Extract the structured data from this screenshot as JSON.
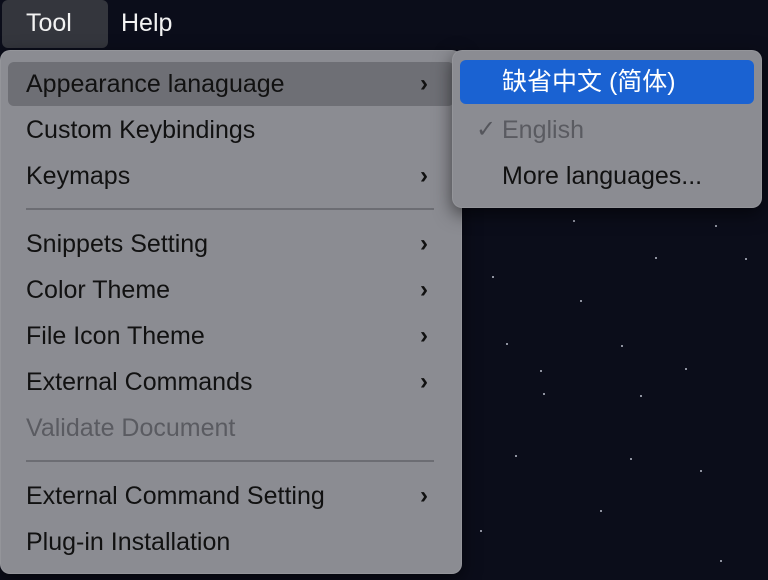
{
  "menubar": {
    "items": [
      {
        "label": "Tool"
      },
      {
        "label": "Help"
      }
    ]
  },
  "tool_menu": {
    "items": [
      {
        "label": "Appearance lanaguage"
      },
      {
        "label": "Custom Keybindings"
      },
      {
        "label": "Keymaps"
      },
      {
        "label": "Snippets Setting"
      },
      {
        "label": "Color Theme"
      },
      {
        "label": "File Icon Theme"
      },
      {
        "label": "External Commands"
      },
      {
        "label": "Validate Document"
      },
      {
        "label": "External Command Setting"
      },
      {
        "label": "Plug-in Installation"
      }
    ],
    "chevron": "›"
  },
  "language_submenu": {
    "items": [
      {
        "label": "缺省中文 (简体)"
      },
      {
        "label": "English"
      },
      {
        "label": "More languages..."
      }
    ],
    "checkmark": "✓"
  },
  "colors": {
    "desktop": "#0b0d1a",
    "menu_bg": "#8b8c92",
    "highlight": "#6e6f75",
    "selection": "#1a62d2"
  }
}
